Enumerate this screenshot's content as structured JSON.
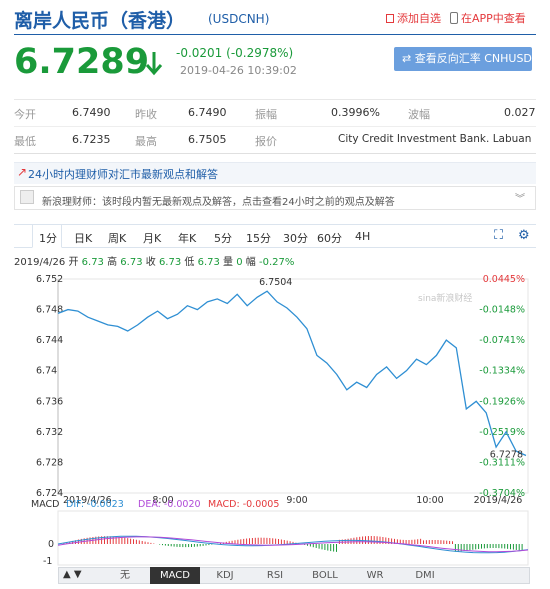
{
  "header": {
    "title": "离岸人民币（香港）",
    "code": "(USDCNH)",
    "add_watch": "添加自选",
    "app_view": "在APP中查看"
  },
  "quote": {
    "price": "6.7289",
    "change": "-0.0201 (-0.2978%)",
    "datetime": "2019-04-26 10:39:02",
    "reverse_button": "查看反向汇率 CNHUSD"
  },
  "stats": {
    "row1": [
      {
        "label": "今开",
        "value": "6.7490"
      },
      {
        "label": "昨收",
        "value": "6.7490"
      },
      {
        "label": "振幅",
        "value": "0.3996%"
      },
      {
        "label": "波幅",
        "value": "0.027"
      }
    ],
    "row2": [
      {
        "label": "最低",
        "value": "6.7235"
      },
      {
        "label": "最高",
        "value": "6.7505"
      },
      {
        "label": "报价",
        "value": "City Credit Investment Bank. Labuan"
      }
    ]
  },
  "news": {
    "title": "24小时内理财师对汇市最新观点和解答",
    "comment": "新浪理财师：该时段内暂无最新观点及解答，点击查看24小时之前的观点及解答"
  },
  "tabs": [
    "1分",
    "日K",
    "周K",
    "月K",
    "年K",
    "5分",
    "15分",
    "30分",
    "60分",
    "4H"
  ],
  "info": {
    "date": "2019/4/26",
    "open_l": "开",
    "open": "6.73",
    "high_l": "高",
    "high": "6.73",
    "close_l": "收",
    "close": "6.73",
    "low_l": "低",
    "low": "6.73",
    "vol_l": "量",
    "vol": "0",
    "amp_l": "幅",
    "amp": "-0.27%"
  },
  "watermark": "sina新浪财经",
  "macd": {
    "label": "MACD",
    "dif": "DIF: -0.0023",
    "dea": "DEA: -0.0020",
    "macd": "MACD: -0.0005",
    "ticks": [
      "0",
      "-1"
    ]
  },
  "indicators": [
    "无",
    "MACD",
    "KDJ",
    "RSI",
    "BOLL",
    "WR",
    "DMI"
  ],
  "colors": {
    "price_up": "#e4393c",
    "price_down": "#1a9a3a",
    "line": "#2f8fd3",
    "accent": "#1f5ea8"
  },
  "chart_data": {
    "type": "line",
    "title": "",
    "xlabel": "",
    "ylabel": "",
    "ylim": [
      6.724,
      6.752
    ],
    "y_ticks": [
      "6.752",
      "6.748",
      "6.744",
      "6.74",
      "6.736",
      "6.732",
      "6.728",
      "6.724"
    ],
    "pct_ticks": [
      "0.0445%",
      "-0.0148%",
      "-0.0741%",
      "-0.1334%",
      "-0.1926%",
      "-0.2519%",
      "-0.3111%",
      "-0.3704%"
    ],
    "x_ticks": [
      "2019/4/26",
      "8:00",
      "9:00",
      "10:00",
      "2019/4/26"
    ],
    "high_label": "6.7504",
    "low_label": "6.7278",
    "x": [
      0,
      5,
      10,
      15,
      20,
      25,
      30,
      35,
      40,
      45,
      50,
      55,
      60,
      65,
      70,
      75,
      80,
      85,
      90,
      95,
      100,
      105,
      110,
      115,
      120,
      125,
      130,
      135,
      140,
      145,
      150,
      155,
      160,
      165,
      170,
      175,
      180,
      185,
      190,
      195,
      200,
      205,
      210,
      215,
      220,
      225,
      230,
      235
    ],
    "values": [
      6.7475,
      6.748,
      6.7478,
      6.747,
      6.7465,
      6.746,
      6.7458,
      6.7452,
      6.746,
      6.747,
      6.7478,
      6.7468,
      6.7474,
      6.7485,
      6.748,
      6.749,
      6.7494,
      6.7488,
      6.75,
      6.7485,
      6.7496,
      6.7504,
      6.749,
      6.7482,
      6.747,
      6.7455,
      6.742,
      6.741,
      6.7395,
      6.7375,
      6.7385,
      6.7378,
      6.7395,
      6.7405,
      6.739,
      6.74,
      6.7415,
      6.7408,
      6.742,
      6.744,
      6.743,
      6.735,
      6.736,
      6.7345,
      6.73,
      6.732,
      6.7295,
      6.7289
    ]
  }
}
